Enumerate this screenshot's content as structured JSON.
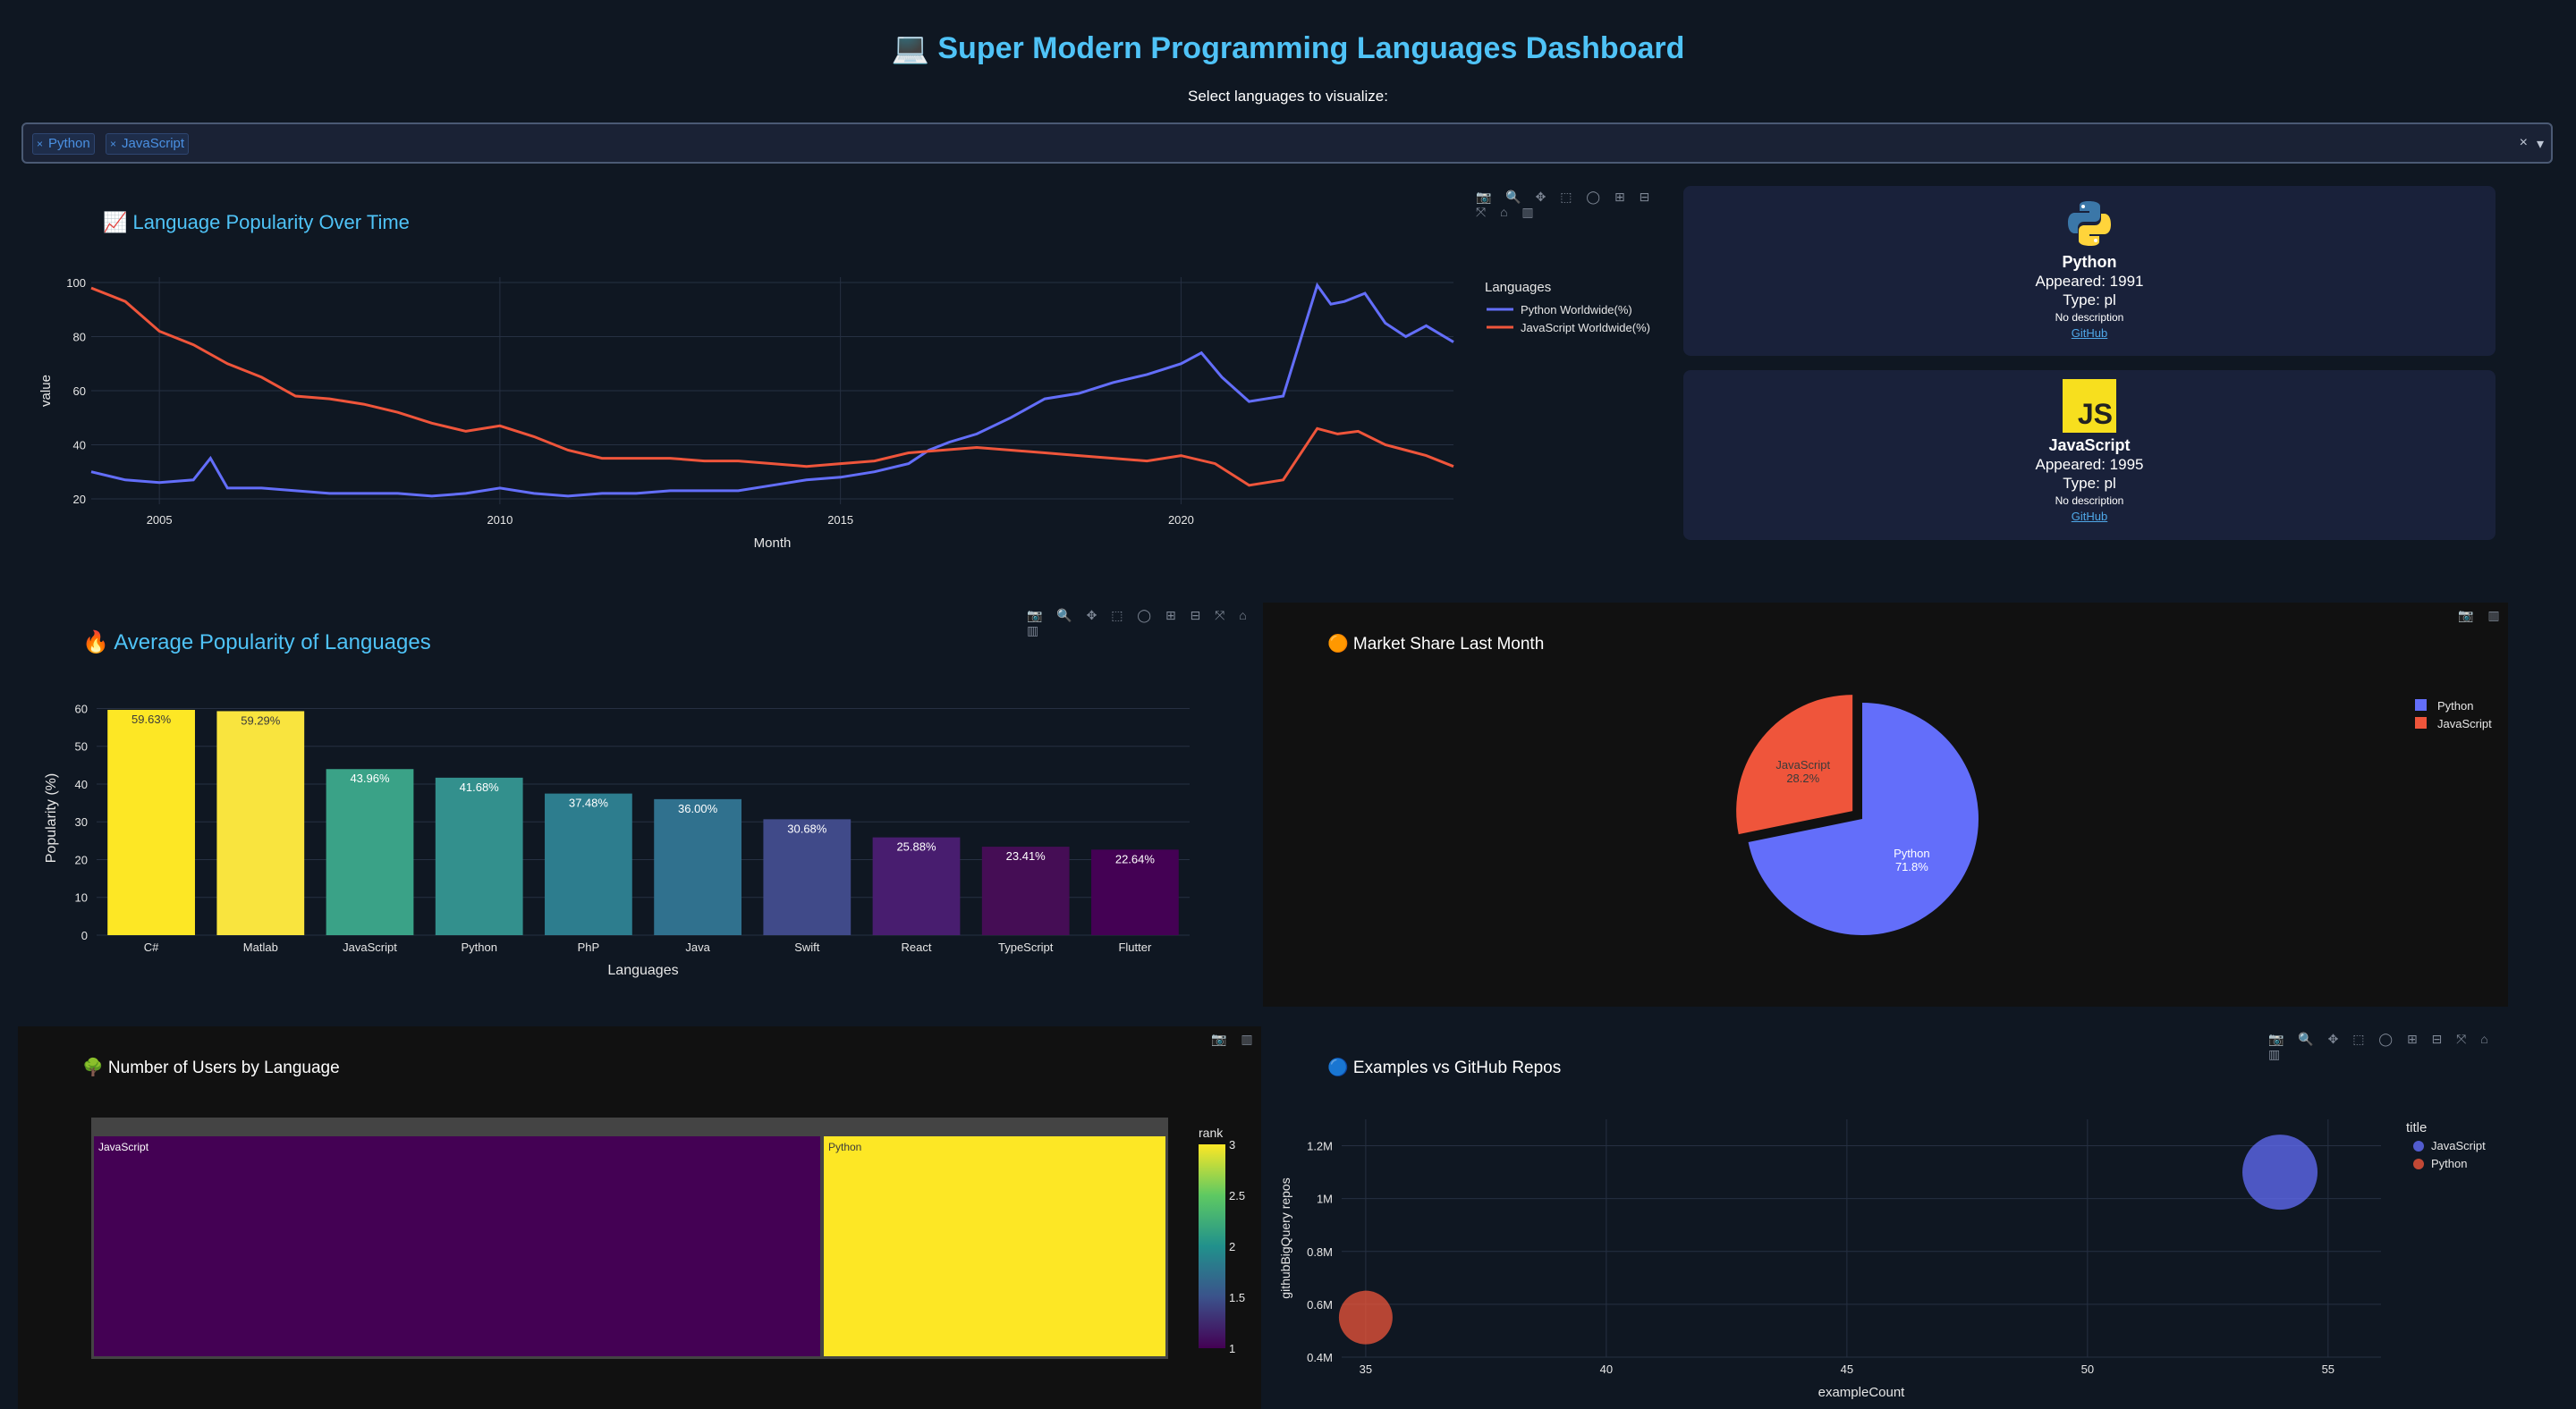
{
  "header": {
    "title": "💻 Super Modern Programming Languages Dashboard",
    "select_label": "Select languages to visualize:"
  },
  "selector": {
    "chips": [
      "Python",
      "JavaScript"
    ],
    "chip_remove": "×",
    "clear": "×",
    "toggle": "▾"
  },
  "line_chart": {
    "title": "📈 Language Popularity Over Time",
    "legend_title": "Languages",
    "chart_data": {
      "type": "line",
      "xlabel": "Month",
      "ylabel": "value",
      "ylim": [
        18,
        102
      ],
      "xlim": [
        "2004-01",
        "2024-01"
      ],
      "x_ticks": [
        "2005",
        "2010",
        "2015",
        "2020"
      ],
      "y_ticks": [
        20,
        40,
        60,
        80,
        100
      ],
      "grid": true,
      "legend_position": "right",
      "series": [
        {
          "name": "Python Worldwide(%)",
          "color": "#636efa",
          "x": [
            2004.0,
            2004.5,
            2005.0,
            2005.5,
            2005.75,
            2006.0,
            2006.5,
            2007.0,
            2007.5,
            2008.0,
            2008.5,
            2009.0,
            2009.5,
            2010.0,
            2010.5,
            2011.0,
            2011.5,
            2012.0,
            2012.5,
            2013.0,
            2013.5,
            2014.0,
            2014.5,
            2015.0,
            2015.5,
            2016.0,
            2016.3,
            2016.6,
            2017.0,
            2017.5,
            2018.0,
            2018.5,
            2019.0,
            2019.5,
            2020.0,
            2020.3,
            2020.6,
            2021.0,
            2021.5,
            2022.0,
            2022.2,
            2022.4,
            2022.7,
            2023.0,
            2023.3,
            2023.6,
            2024.0
          ],
          "y": [
            30,
            27,
            26,
            27,
            35,
            24,
            24,
            23,
            22,
            22,
            22,
            21,
            22,
            24,
            22,
            21,
            22,
            22,
            23,
            23,
            23,
            25,
            27,
            28,
            30,
            33,
            38,
            41,
            44,
            50,
            57,
            59,
            63,
            66,
            70,
            74,
            65,
            56,
            58,
            99,
            92,
            93,
            96,
            85,
            80,
            84,
            78
          ]
        },
        {
          "name": "JavaScript Worldwide(%)",
          "color": "#ef553b",
          "x": [
            2004.0,
            2004.5,
            2005.0,
            2005.5,
            2006.0,
            2006.5,
            2007.0,
            2007.5,
            2008.0,
            2008.5,
            2009.0,
            2009.5,
            2010.0,
            2010.5,
            2011.0,
            2011.5,
            2012.0,
            2012.5,
            2013.0,
            2013.5,
            2014.0,
            2014.5,
            2015.0,
            2015.5,
            2016.0,
            2016.5,
            2017.0,
            2017.5,
            2018.0,
            2018.5,
            2019.0,
            2019.5,
            2020.0,
            2020.5,
            2021.0,
            2021.5,
            2022.0,
            2022.3,
            2022.6,
            2023.0,
            2023.3,
            2023.6,
            2024.0
          ],
          "y": [
            98,
            93,
            82,
            77,
            70,
            65,
            58,
            57,
            55,
            52,
            48,
            45,
            47,
            43,
            38,
            35,
            35,
            35,
            34,
            34,
            33,
            32,
            33,
            34,
            37,
            38,
            39,
            38,
            37,
            36,
            35,
            34,
            36,
            33,
            25,
            27,
            46,
            44,
            45,
            40,
            38,
            36,
            32
          ]
        }
      ]
    }
  },
  "cards": [
    {
      "name": "Python",
      "appeared": "Appeared: 1991",
      "type": "Type: pl",
      "desc": "No description",
      "link": "GitHub",
      "logo": "python-logo"
    },
    {
      "name": "JavaScript",
      "appeared": "Appeared: 1995",
      "type": "Type: pl",
      "desc": "No description",
      "link": "GitHub",
      "logo": "js-logo",
      "logo_text": "JS"
    }
  ],
  "bar_chart": {
    "title": "🔥 Average Popularity of Languages",
    "chart_data": {
      "type": "bar",
      "categories": [
        "C#",
        "Matlab",
        "JavaScript",
        "Python",
        "PhP",
        "Java",
        "Swift",
        "React",
        "TypeScript",
        "Flutter"
      ],
      "values": [
        59.63,
        59.29,
        43.96,
        41.68,
        37.48,
        36.0,
        30.68,
        25.88,
        23.41,
        22.64
      ],
      "labels": [
        "59.63%",
        "59.29%",
        "43.96%",
        "41.68%",
        "37.48%",
        "36.00%",
        "30.68%",
        "25.88%",
        "23.41%",
        "22.64%"
      ],
      "colors": [
        "#fde725",
        "#f9e43e",
        "#3aa287",
        "#33908d",
        "#2d7d8e",
        "#30718e",
        "#404a89",
        "#481d6f",
        "#450d55",
        "#440154"
      ],
      "label_colors": [
        "#3b3b3b",
        "#3b3b3b",
        "#ffffff",
        "#ffffff",
        "#ffffff",
        "#ffffff",
        "#ffffff",
        "#ffffff",
        "#ffffff",
        "#ffffff"
      ],
      "xlabel": "Languages",
      "ylabel": "Popularity (%)",
      "ylim": [
        0,
        62
      ],
      "y_ticks": [
        0,
        10,
        20,
        30,
        40,
        50,
        60
      ],
      "grid": true
    }
  },
  "pie_chart": {
    "title": "🟠 Market Share Last Month",
    "chart_data": {
      "type": "pie",
      "labels": [
        "Python",
        "JavaScript"
      ],
      "values": [
        71.8,
        28.2
      ],
      "slice_labels": [
        "Python\n71.8%",
        "JavaScript\n28.2%"
      ],
      "colors": [
        "#636efa",
        "#ef553b"
      ],
      "pulled": "JavaScript",
      "legend_position": "top-right"
    }
  },
  "treemap": {
    "title": "🌳 Number of Users by Language",
    "chart_data": {
      "type": "treemap",
      "labels": [
        "JavaScript",
        "Python"
      ],
      "rank": [
        1,
        3
      ],
      "colors": [
        "#440154",
        "#fde725"
      ],
      "colorbar_title": "rank",
      "colorbar_ticks": [
        "3",
        "2.5",
        "2",
        "1.5",
        "1"
      ]
    }
  },
  "scatter": {
    "title": "🔵 Examples vs GitHub Repos",
    "legend_title": "title",
    "chart_data": {
      "type": "scatter",
      "xlabel": "exampleCount",
      "ylabel": "githubBigQuery repos",
      "xlim": [
        34.5,
        56.1
      ],
      "ylim": [
        0.4,
        1.3
      ],
      "x_ticks": [
        "35",
        "40",
        "45",
        "50",
        "55"
      ],
      "y_ticks": [
        "0.4M",
        "0.6M",
        "0.8M",
        "1M",
        "1.2M"
      ],
      "series": [
        {
          "name": "JavaScript",
          "color": "#636efa",
          "x": [
            54
          ],
          "y": [
            1.1
          ],
          "size": "large"
        },
        {
          "name": "Python",
          "color": "#ef553b",
          "x": [
            35
          ],
          "y": [
            0.55
          ],
          "size": "small"
        }
      ],
      "legend_position": "top-right"
    }
  },
  "modebar": {
    "full": "📷 🔍 ✥ ⬚ ◯ ⊞ ⊟ ⤧ ⌂ ▥",
    "short": "📷 ▥"
  }
}
